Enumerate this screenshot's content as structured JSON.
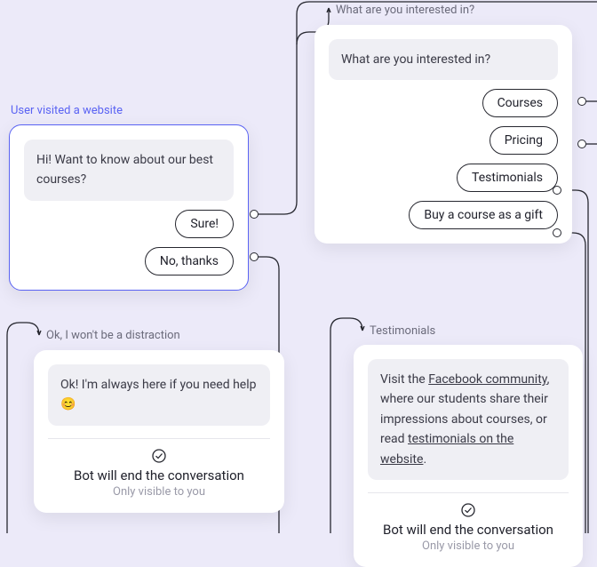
{
  "node1": {
    "title": "User visited a website",
    "message": "Hi! Want to know about our best courses?",
    "btn_sure": "Sure!",
    "btn_no": "No, thanks"
  },
  "node2": {
    "title": "What are you interested in?",
    "message": "What are you interested in?",
    "btn_courses": "Courses",
    "btn_pricing": "Pricing",
    "btn_testimonials": "Testimonials",
    "btn_gift": "Buy a course as a gift"
  },
  "node3": {
    "title": "Ok, I won't be a distraction",
    "message": "Ok! I'm always here if you need help 😊",
    "end_text": "Bot will end the conversation",
    "ov_text": "Only visible to you"
  },
  "node4": {
    "title": "Testimonials",
    "msg_p1": "Visit the ",
    "msg_link1": "Facebook community",
    "msg_p2": ", where our students share their impressions about courses, or read ",
    "msg_link2": "testimonials on the website",
    "msg_p3": ".",
    "end_text": "Bot will end the conversation",
    "ov_text": "Only visible to you"
  }
}
